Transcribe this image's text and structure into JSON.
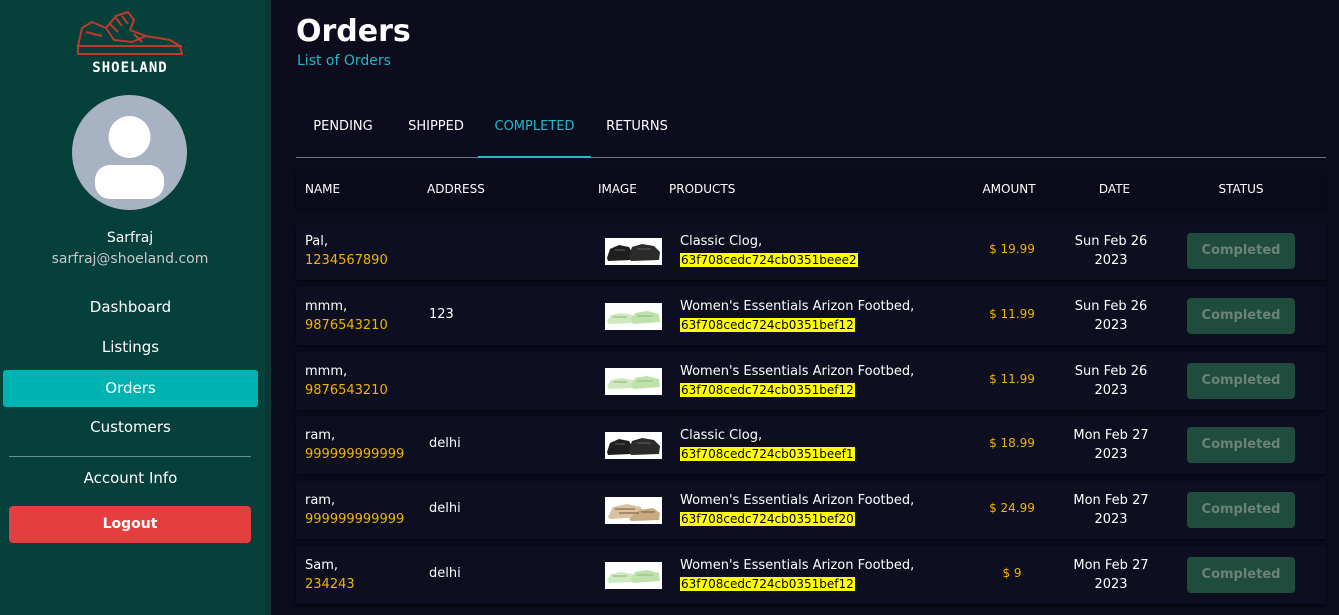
{
  "brand": {
    "name": "SHOELAND",
    "logo_color": "#c0392b"
  },
  "user": {
    "name": "Sarfraj",
    "email": "sarfraj@shoeland.com"
  },
  "nav": {
    "items": [
      {
        "label": "Dashboard"
      },
      {
        "label": "Listings"
      },
      {
        "label": "Orders",
        "active": true
      },
      {
        "label": "Customers"
      }
    ],
    "account_info": "Account Info",
    "logout": "Logout"
  },
  "page": {
    "title": "Orders",
    "subtitle": "List of Orders"
  },
  "tabs": [
    {
      "label": "PENDING"
    },
    {
      "label": "SHIPPED"
    },
    {
      "label": "COMPLETED",
      "active": true
    },
    {
      "label": "RETURNS"
    }
  ],
  "table": {
    "headers": [
      "NAME",
      "ADDRESS",
      "IMAGE",
      "PRODUCTS",
      "AMOUNT",
      "DATE",
      "STATUS"
    ],
    "rows": [
      {
        "name": "Pal,",
        "phone": "1234567890",
        "address": "",
        "image": "black-clog",
        "product": "Classic Clog,",
        "product_id": "63f708cedc724cb0351beee2",
        "amount": "$ 19.99",
        "date_line1": "Sun Feb 26",
        "date_line2": "2023",
        "status": "Completed"
      },
      {
        "name": "mmm,",
        "phone": "9876543210",
        "address": "123",
        "image": "green-sandal",
        "product": "Women's Essentials Arizon Footbed,",
        "product_id": "63f708cedc724cb0351bef12",
        "amount": "$ 11.99",
        "date_line1": "Sun Feb 26",
        "date_line2": "2023",
        "status": "Completed"
      },
      {
        "name": "mmm,",
        "phone": "9876543210",
        "address": "",
        "image": "green-sandal",
        "product": "Women's Essentials Arizon Footbed,",
        "product_id": "63f708cedc724cb0351bef12",
        "amount": "$ 11.99",
        "date_line1": "Sun Feb 26",
        "date_line2": "2023",
        "status": "Completed"
      },
      {
        "name": "ram,",
        "phone": "999999999999",
        "address": "delhi",
        "image": "black-clog",
        "product": "Classic Clog,",
        "product_id": "63f708cedc724cb0351beef1",
        "amount": "$ 18.99",
        "date_line1": "Mon Feb 27",
        "date_line2": "2023",
        "status": "Completed"
      },
      {
        "name": "ram,",
        "phone": "999999999999",
        "address": "delhi",
        "image": "tan-sandal",
        "product": "Women's Essentials Arizon Footbed,",
        "product_id": "63f708cedc724cb0351bef20",
        "amount": "$ 24.99",
        "date_line1": "Mon Feb 27",
        "date_line2": "2023",
        "status": "Completed"
      },
      {
        "name": "Sam,",
        "phone": "234243",
        "address": "delhi",
        "image": "green-sandal",
        "product": "Women's Essentials Arizon Footbed,",
        "product_id": "63f708cedc724cb0351bef12",
        "amount": "$ 9",
        "date_line1": "Mon Feb 27",
        "date_line2": "2023",
        "status": "Completed"
      }
    ]
  }
}
